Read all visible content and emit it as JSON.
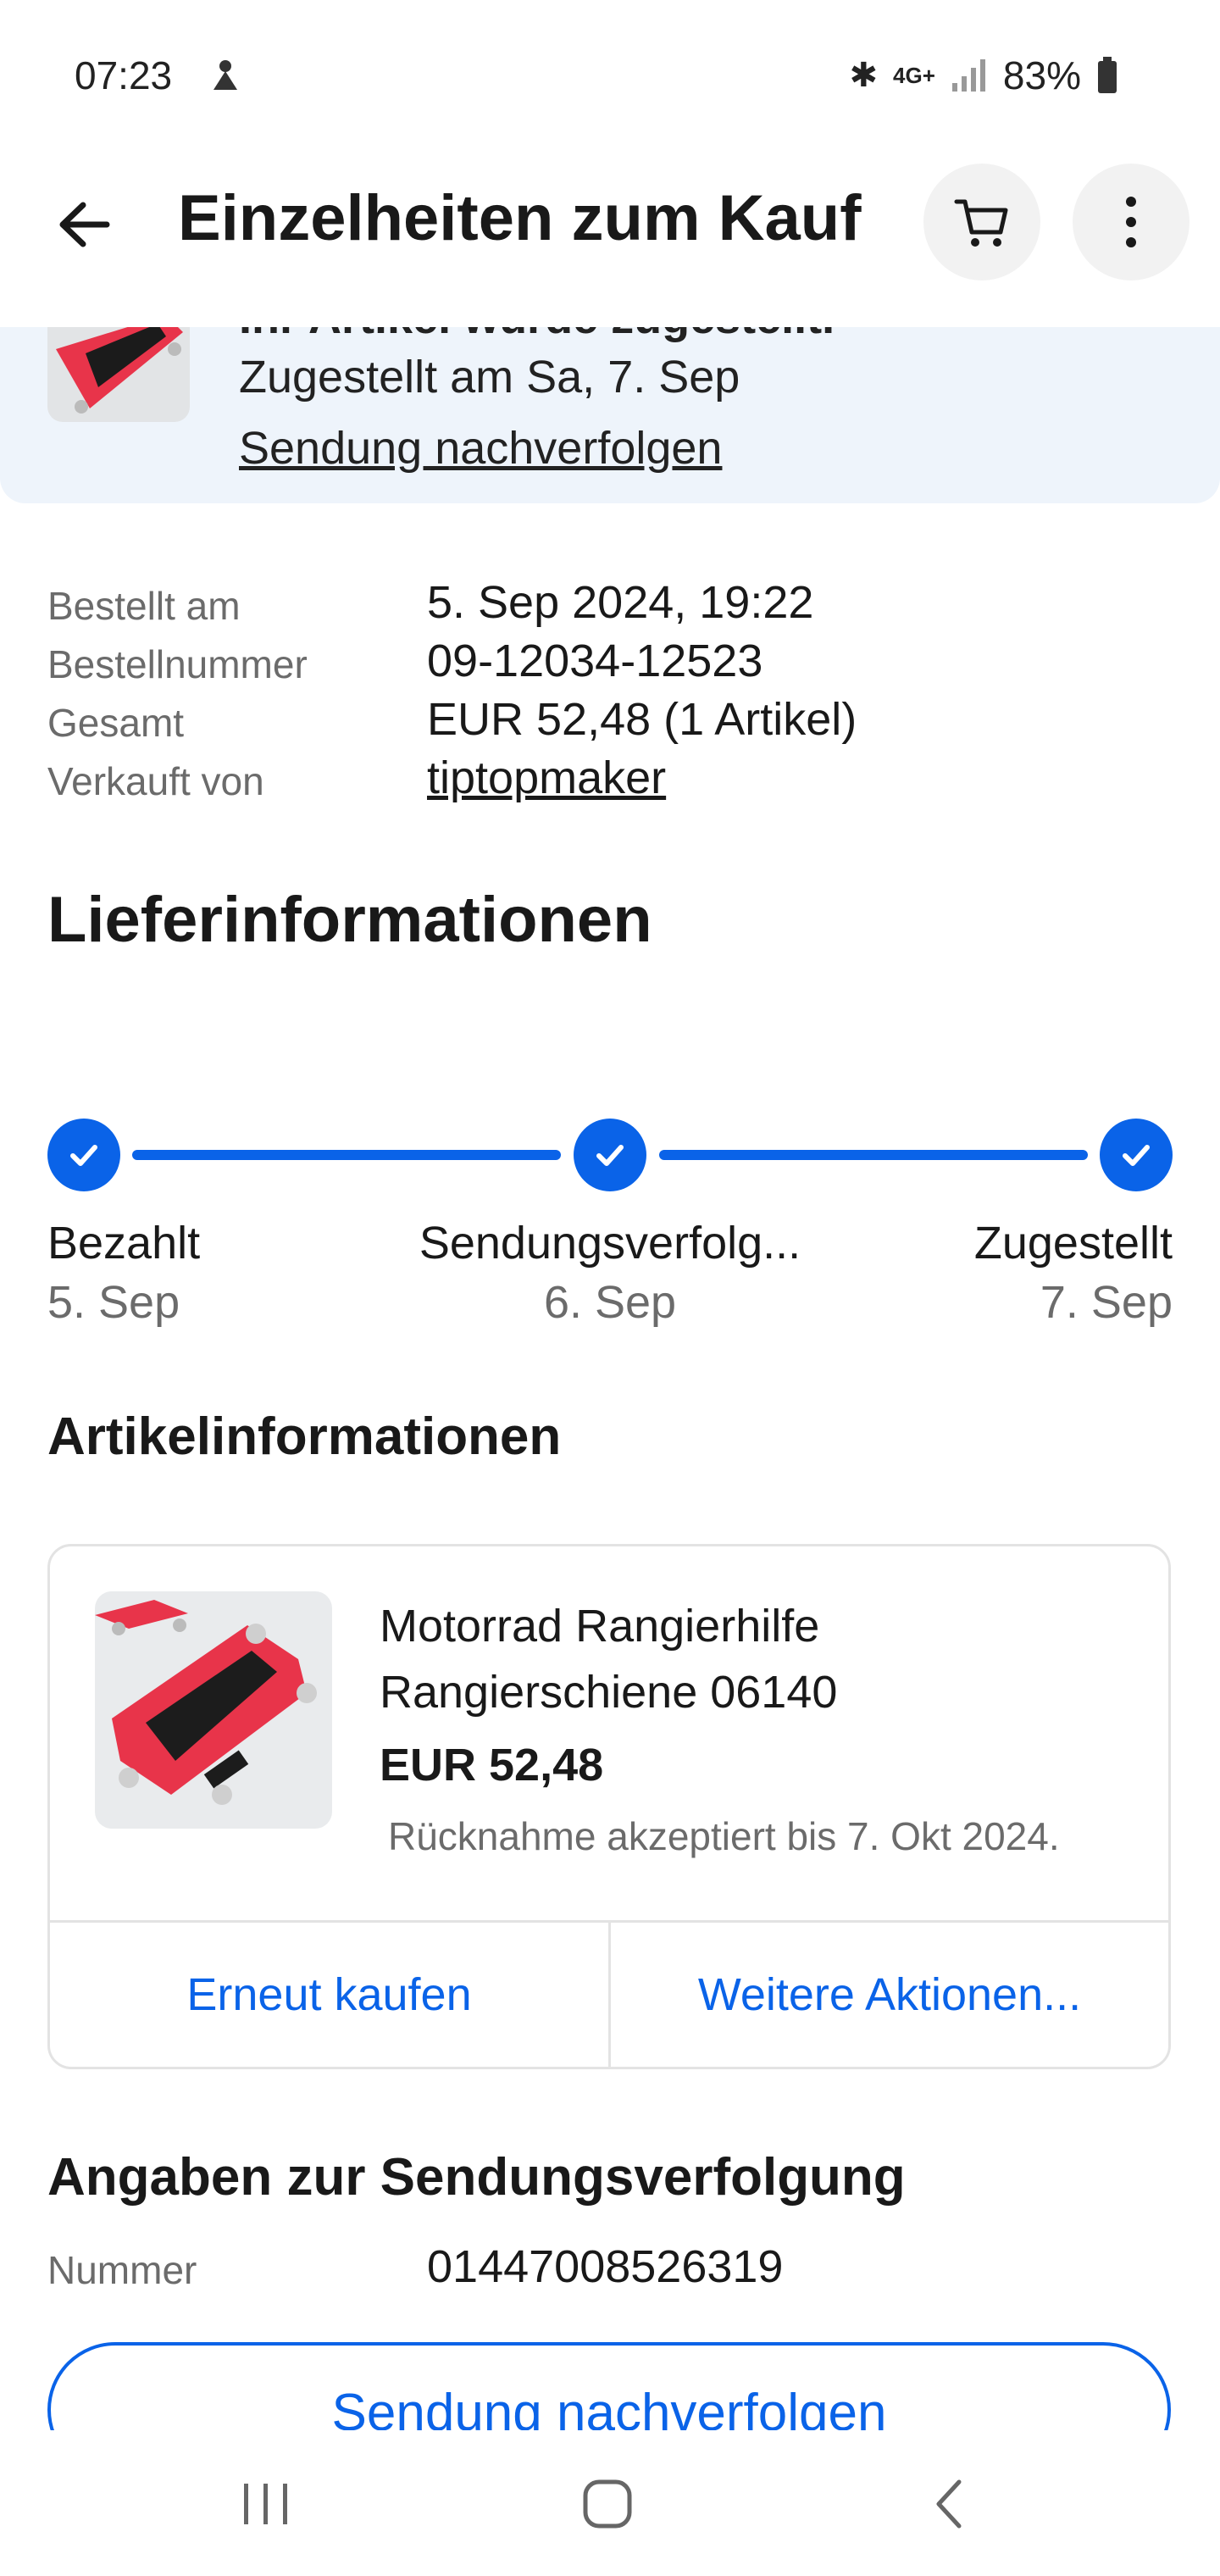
{
  "status_bar": {
    "time": "07:23",
    "battery": "83%",
    "network": "4G+"
  },
  "app_bar": {
    "title": "Einzelheiten zum Kauf",
    "icons": [
      "back-arrow-icon",
      "cart-icon",
      "more-vertical-icon"
    ]
  },
  "banner": {
    "cut_headline": "Ihr Artikel wurde zugestellt.",
    "delivered_text": "Zugestellt am Sa, 7. Sep",
    "track_link": "Sendung nachverfolgen"
  },
  "order_info": {
    "rows": [
      {
        "label": "Bestellt am",
        "value": "5. Sep 2024, 19:22"
      },
      {
        "label": "Bestellnummer",
        "value": "09-12034-12523"
      },
      {
        "label": "Gesamt",
        "value": "EUR 52,48 (1 Artikel)"
      },
      {
        "label": "Verkauft von",
        "value": "tiptopmaker"
      }
    ]
  },
  "delivery": {
    "heading": "Lieferinformationen",
    "steps": [
      {
        "label": "Bezahlt",
        "date": "5. Sep"
      },
      {
        "label": "Sendungsverfolg...",
        "date": "6. Sep"
      },
      {
        "label": "Zugestellt",
        "date": "7. Sep"
      }
    ],
    "progress_fraction": 1.0
  },
  "item_info": {
    "heading": "Artikelinformationen",
    "title": "Motorrad Rangierhilfe Rangierschiene 06140",
    "price": "EUR 52,48",
    "return_note": "Rücknahme akzeptiert bis 7. Okt 2024.",
    "action_buy_again": "Erneut kaufen",
    "action_more": "Weitere Aktionen..."
  },
  "tracking": {
    "heading": "Angaben zur Sendungsverfolgung",
    "number_label": "Nummer",
    "number_value": "01447008526319",
    "button_label": "Sendung nachverfolgen"
  },
  "colors": {
    "accent": "#0a63e8",
    "banner_bg": "#eef4fb",
    "muted_text": "#6b6b6b",
    "product_red": "#e8344a"
  }
}
